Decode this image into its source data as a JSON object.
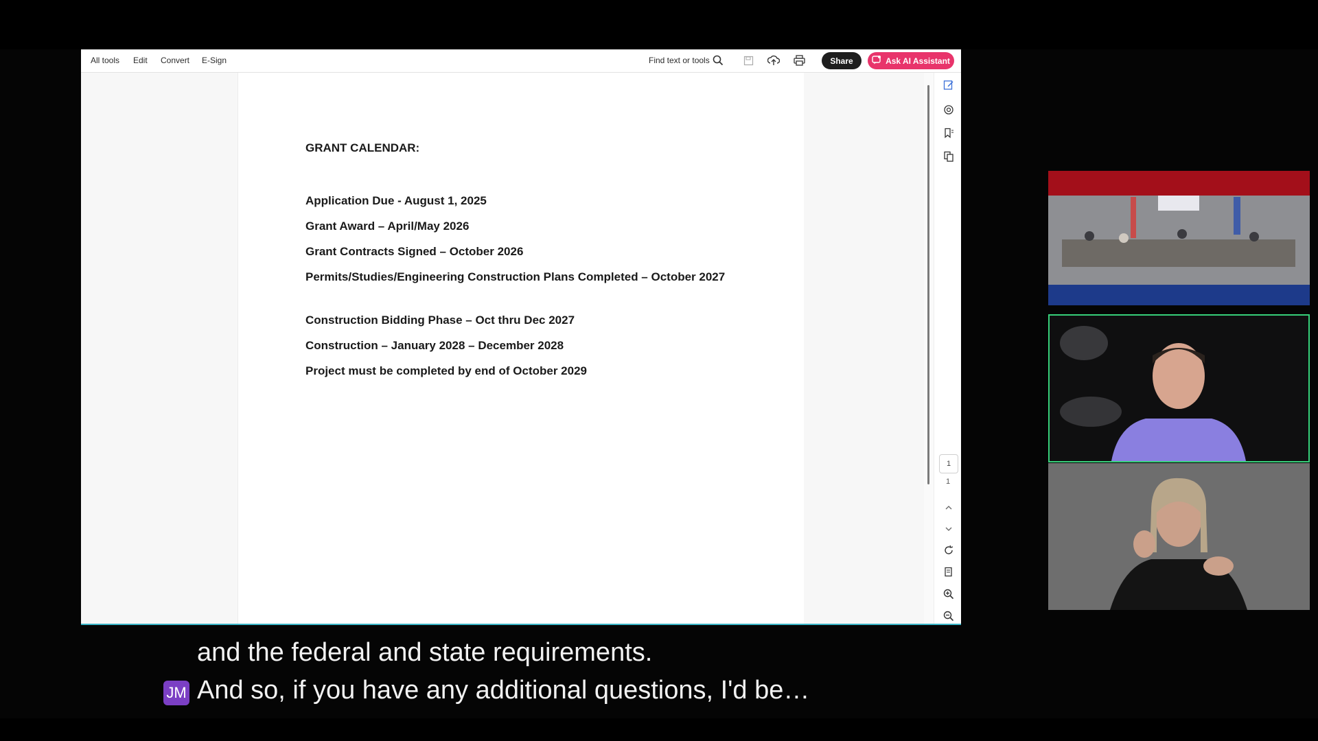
{
  "toolbar": {
    "menu": [
      "All tools",
      "Edit",
      "Convert",
      "E-Sign"
    ],
    "find_label": "Find text or tools",
    "share_label": "Share",
    "ai_label": "Ask AI Assistant"
  },
  "document": {
    "heading": "GRANT CALENDAR:",
    "lines": [
      "Application Due - August 1, 2025",
      "Grant Award – April/May 2026",
      "Grant Contracts Signed – October 2026",
      "Permits/Studies/Engineering Construction Plans Completed – October 2027",
      "Construction Bidding Phase – Oct thru Dec 2027",
      "Construction – January 2028 – December 2028",
      "Project must be completed by end of October 2029"
    ]
  },
  "pager": {
    "current_page": "1",
    "total_pages": "1"
  },
  "captions": {
    "line1": "and the federal and state requirements.",
    "line2": "And so, if you have any additional questions, I'd be…",
    "speaker_initials": "JM"
  },
  "colors": {
    "accent_ai": "#e8346b",
    "active_speaker_border": "#37d07a",
    "speaker_badge": "#7b3fc4"
  }
}
